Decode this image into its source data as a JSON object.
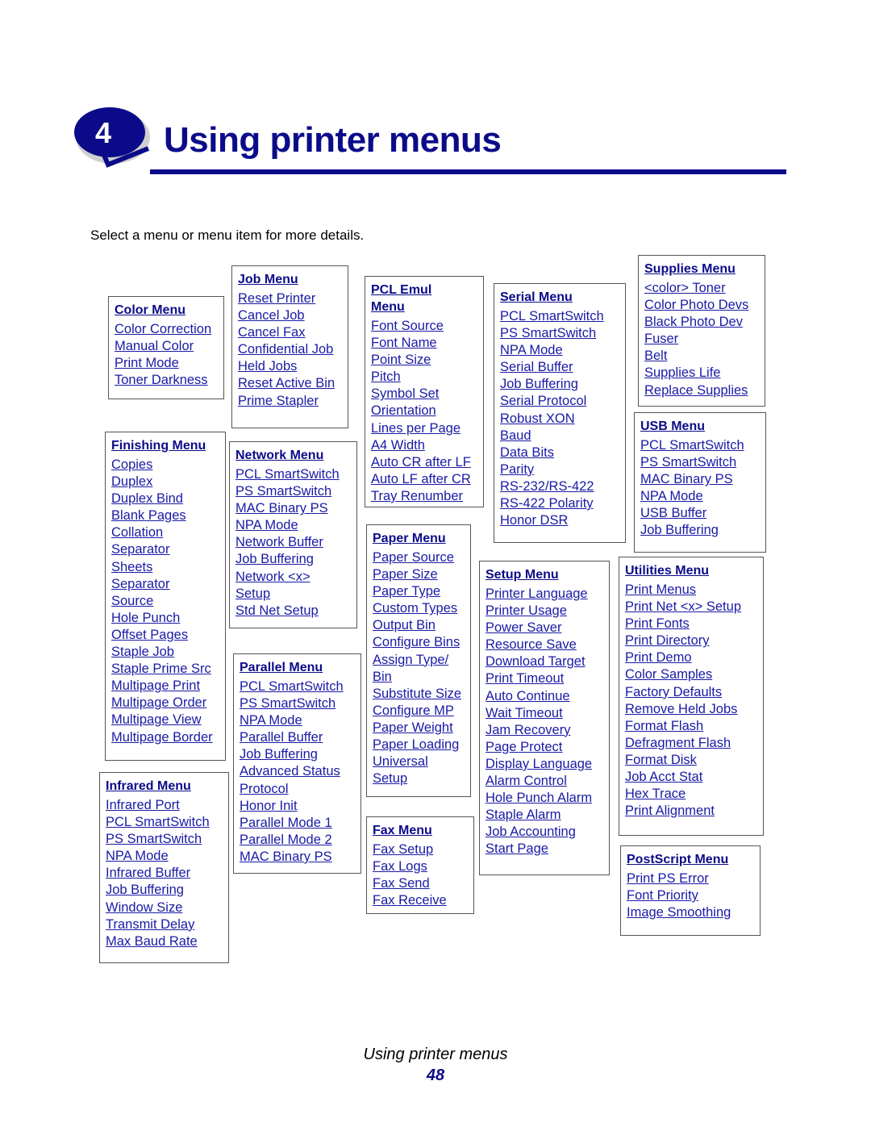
{
  "header": {
    "chapter_number": "4",
    "title": "Using printer menus",
    "intro": "Select a menu or menu item for more details."
  },
  "colors": {
    "brand_blue": "#0b0b8a",
    "link_blue": "#1a1aa6"
  },
  "menus": {
    "color": {
      "title": "Color Menu",
      "items": [
        "Color Correction",
        "Manual Color",
        "Print Mode",
        "Toner Darkness"
      ]
    },
    "job": {
      "title": "Job Menu",
      "items": [
        "Reset Printer",
        "Cancel Job",
        "Cancel Fax",
        "Confidential Job",
        "Held Jobs",
        "Reset Active Bin",
        "Prime Stapler"
      ]
    },
    "pcl_emul": {
      "title_line1": "PCL Emul",
      "title_line2": "Menu",
      "items": [
        "Font Source",
        "Font Name",
        "Point Size",
        "Pitch",
        "Symbol Set",
        "Orientation",
        "Lines per Page",
        "A4 Width",
        "Auto CR after LF",
        "Auto LF after CR",
        "Tray Renumber"
      ]
    },
    "serial": {
      "title": "Serial Menu",
      "items": [
        "PCL SmartSwitch",
        "PS SmartSwitch",
        "NPA Mode",
        "Serial Buffer",
        "Job Buffering",
        "Serial Protocol",
        "Robust XON",
        "Baud",
        "Data Bits",
        "Parity",
        "RS-232/RS-422",
        "RS-422 Polarity",
        "Honor DSR"
      ]
    },
    "supplies": {
      "title": "Supplies Menu",
      "items": [
        "<color> Toner",
        "Color Photo Devs",
        "Black Photo Dev",
        "Fuser",
        "Belt",
        "Supplies Life",
        "Replace Supplies"
      ]
    },
    "finishing": {
      "title": "Finishing Menu",
      "items": [
        "Copies",
        "Duplex",
        "Duplex Bind",
        "Blank Pages",
        "Collation",
        "Separator",
        "Sheets",
        "Separator",
        "Source",
        "Hole Punch",
        "Offset Pages",
        "Staple Job",
        "Staple Prime Src",
        "Multipage Print",
        "Multipage Order",
        "Multipage View",
        "Multipage Border"
      ]
    },
    "network": {
      "title": "Network Menu",
      "items": [
        "PCL SmartSwitch",
        "PS SmartSwitch",
        "MAC Binary PS",
        "NPA Mode",
        "Network Buffer",
        "Job Buffering",
        "Network <x>",
        "Setup",
        "Std Net Setup"
      ]
    },
    "usb": {
      "title": "USB Menu",
      "items": [
        "PCL SmartSwitch",
        "PS SmartSwitch",
        "MAC Binary PS",
        "NPA Mode",
        "USB Buffer",
        "Job Buffering"
      ]
    },
    "paper": {
      "title": "Paper Menu",
      "items": [
        "Paper Source",
        "Paper Size",
        "Paper Type",
        "Custom Types",
        "Output Bin",
        "Configure Bins",
        "Assign Type/",
        "Bin",
        "Substitute Size",
        "Configure MP",
        "Paper Weight",
        "Paper Loading",
        "Universal",
        "Setup"
      ]
    },
    "setup": {
      "title": "Setup Menu",
      "items": [
        "Printer Language",
        "Printer Usage",
        "Power Saver",
        "Resource Save",
        "Download Target",
        "Print Timeout",
        "Auto Continue",
        "Wait Timeout",
        "Jam Recovery",
        "Page Protect",
        "Display Language",
        "Alarm Control",
        "Hole Punch Alarm",
        "Staple Alarm",
        "Job Accounting",
        "Start Page"
      ]
    },
    "utilities": {
      "title": "Utilities Menu",
      "items": [
        "Print Menus",
        "Print Net <x> Setup",
        "Print Fonts",
        "Print Directory",
        "Print Demo",
        "Color Samples",
        "Factory Defaults",
        "Remove Held Jobs",
        "Format Flash",
        "Defragment Flash",
        "Format Disk",
        "Job Acct Stat",
        "Hex Trace",
        "Print Alignment"
      ]
    },
    "parallel": {
      "title": "Parallel Menu",
      "items": [
        "PCL SmartSwitch",
        "PS SmartSwitch",
        "NPA Mode",
        "Parallel Buffer",
        "Job Buffering",
        "Advanced Status",
        "Protocol",
        "Honor Init",
        "Parallel Mode 1",
        "Parallel Mode 2",
        "MAC Binary PS"
      ]
    },
    "infrared": {
      "title": "Infrared Menu",
      "items": [
        "Infrared Port",
        "PCL SmartSwitch",
        "PS SmartSwitch",
        "NPA Mode",
        "Infrared Buffer",
        "Job Buffering",
        "Window Size",
        "Transmit Delay",
        "Max Baud Rate"
      ]
    },
    "fax": {
      "title": "Fax Menu",
      "items": [
        "Fax Setup",
        "Fax Logs",
        "Fax Send",
        "Fax Receive"
      ]
    },
    "postscript": {
      "title": "PostScript Menu",
      "items": [
        "Print PS Error",
        "Font Priority",
        "Image Smoothing"
      ]
    }
  },
  "footer": {
    "section_title": "Using printer menus",
    "page_number": "48"
  }
}
